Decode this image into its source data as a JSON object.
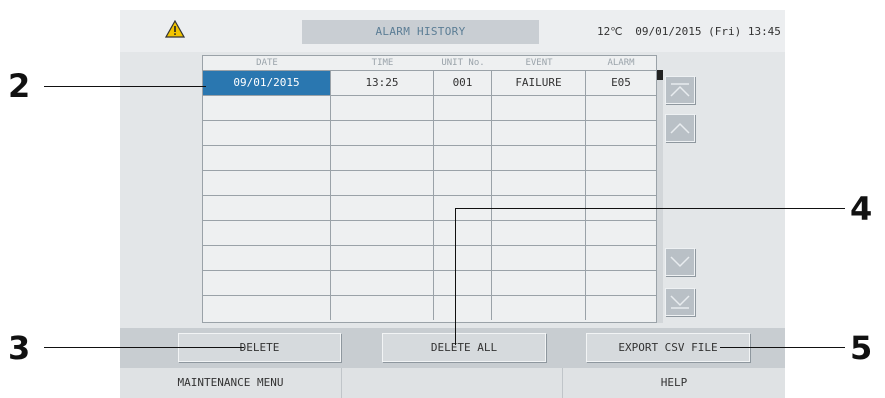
{
  "header": {
    "title": "ALARM HISTORY",
    "temperature": "12℃",
    "datetime": "09/01/2015 (Fri) 13:45"
  },
  "table": {
    "columns": [
      "DATE",
      "TIME",
      "UNIT No.",
      "EVENT",
      "ALARM"
    ],
    "rows": [
      {
        "date": "09/01/2015",
        "time": "13:25",
        "unit": "001",
        "event": "FAILURE",
        "alarm": "E05"
      }
    ]
  },
  "buttons": {
    "delete": "DELETE",
    "delete_all": "DELETE ALL",
    "export_csv": "EXPORT CSV FILE"
  },
  "footer": {
    "maintenance_menu": "MAINTENANCE MENU",
    "help": "HELP"
  },
  "callouts": [
    "2",
    "3",
    "4",
    "5"
  ],
  "colors": {
    "selected_row": "#2a77b0",
    "title_text": "#5b7d95",
    "warning": "#f2c400"
  }
}
